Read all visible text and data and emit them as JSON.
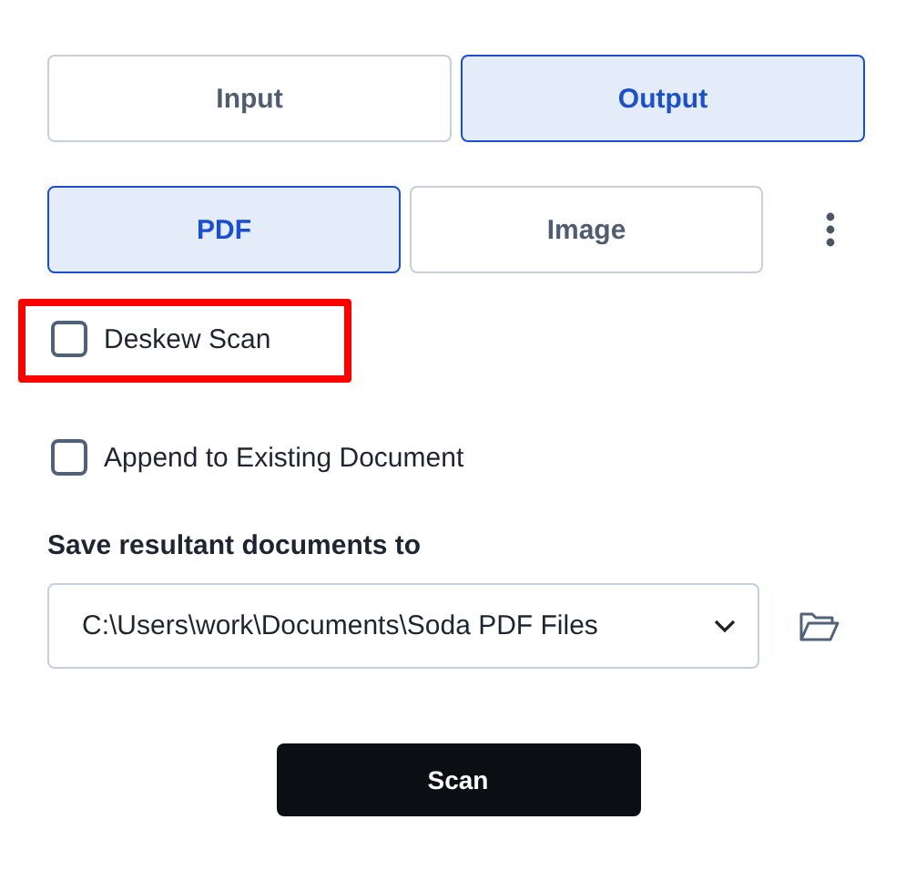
{
  "mode_tabs": [
    {
      "label": "Input",
      "selected": false
    },
    {
      "label": "Output",
      "selected": true
    }
  ],
  "format_tabs": [
    {
      "label": "PDF",
      "selected": true
    },
    {
      "label": "Image",
      "selected": false
    }
  ],
  "options": [
    {
      "label": "Deskew Scan",
      "checked": false,
      "highlighted": true
    },
    {
      "label": "Append to Existing Document",
      "checked": false,
      "highlighted": false
    }
  ],
  "save_label": "Save resultant documents to",
  "save_path": "C:\\Users\\work\\Documents\\Soda PDF Files",
  "scan_button": "Scan"
}
